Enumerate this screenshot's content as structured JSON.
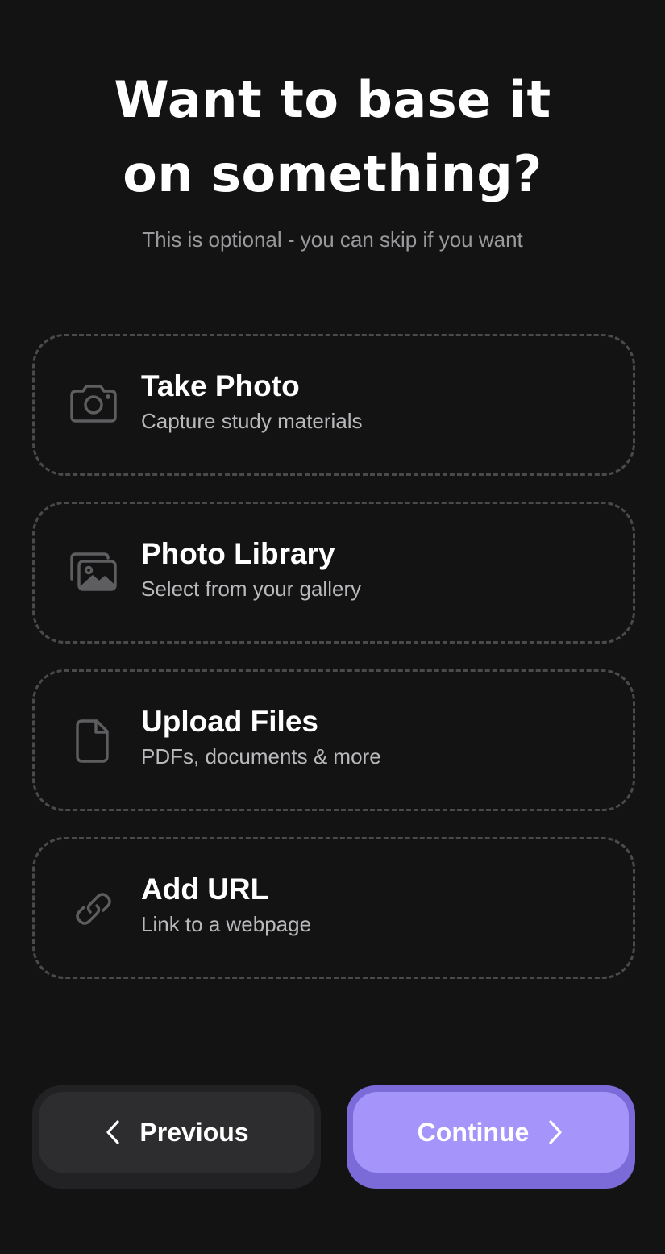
{
  "header": {
    "title_line1": "Want to base it",
    "title_line2": "on something?",
    "subtitle": "This is optional - you can skip if you want"
  },
  "options": [
    {
      "title": "Take Photo",
      "description": "Capture study materials",
      "icon": "camera-icon"
    },
    {
      "title": "Photo Library",
      "description": "Select from your gallery",
      "icon": "gallery-icon"
    },
    {
      "title": "Upload Files",
      "description": "PDFs, documents & more",
      "icon": "file-icon"
    },
    {
      "title": "Add URL",
      "description": "Link to a webpage",
      "icon": "link-icon"
    }
  ],
  "footer": {
    "previous_label": "Previous",
    "continue_label": "Continue"
  },
  "colors": {
    "background": "#141314",
    "accent": "#a594fa",
    "accent_shadow": "#7b6bd8",
    "dashed_border": "#4a494c",
    "muted_text": "#9a999c"
  }
}
